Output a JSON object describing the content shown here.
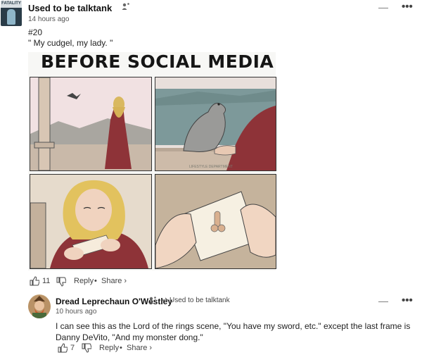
{
  "post": {
    "username": "Used to be talktank",
    "timestamp": "14 hours ago",
    "number": "#20",
    "quote": "\" My cudgel, my lady. \"",
    "avatar_text": "FATALITY",
    "image": {
      "title": "BEFORE SOCIAL MEDIA",
      "watermark": "LIFESTYLE DEPARTMENT"
    },
    "upvotes": "11",
    "reply_label": "Reply",
    "share_label": "Share ›"
  },
  "comment": {
    "username": "Dread Leprechaun O'Westley",
    "reply_to": "Used to be talktank",
    "timestamp": "10 hours ago",
    "text": "I can see this as the Lord of the rings scene, \"You have my sword, etc.\" except the last frame is Danny DeVito, \"And my monster dong.\"",
    "upvotes": "7",
    "reply_label": "Reply",
    "share_label": "Share ›"
  },
  "icons": {
    "more": "more-options-icon",
    "collapse": "collapse-icon",
    "upvote": "thumbs-up-icon",
    "downvote": "thumbs-down-icon",
    "mod": "user-badge-icon",
    "reply_arrow": "reply-arrow-icon"
  }
}
